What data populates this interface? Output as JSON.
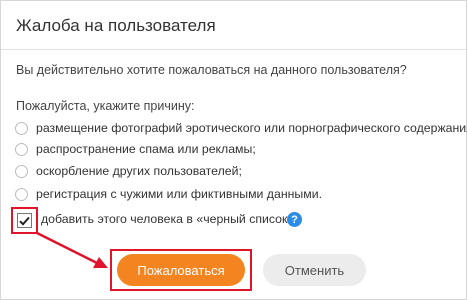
{
  "dialog": {
    "title": "Жалоба на пользователя",
    "question": "Вы действительно хотите пожаловаться на данного пользователя?",
    "reason_title": "Пожалуйста, укажите причину:",
    "reasons": [
      "размещение фотографий эротического или порнографического содержания;",
      "распространение спама или рекламы;",
      "оскорбление других пользователей;",
      "регистрация с чужими или фиктивными данными."
    ],
    "blacklist_label": "добавить этого человека в «черный список»",
    "blacklist_checked": true,
    "help_glyph": "?",
    "submit_label": "Пожаловаться",
    "cancel_label": "Отменить"
  },
  "colors": {
    "accent_orange": "#f48420",
    "annotation_red": "#e0142a",
    "help_blue": "#2a8ee6"
  },
  "icons": [
    "radio-icon",
    "checkbox-checked-icon",
    "help-icon",
    "annotation-arrow"
  ]
}
